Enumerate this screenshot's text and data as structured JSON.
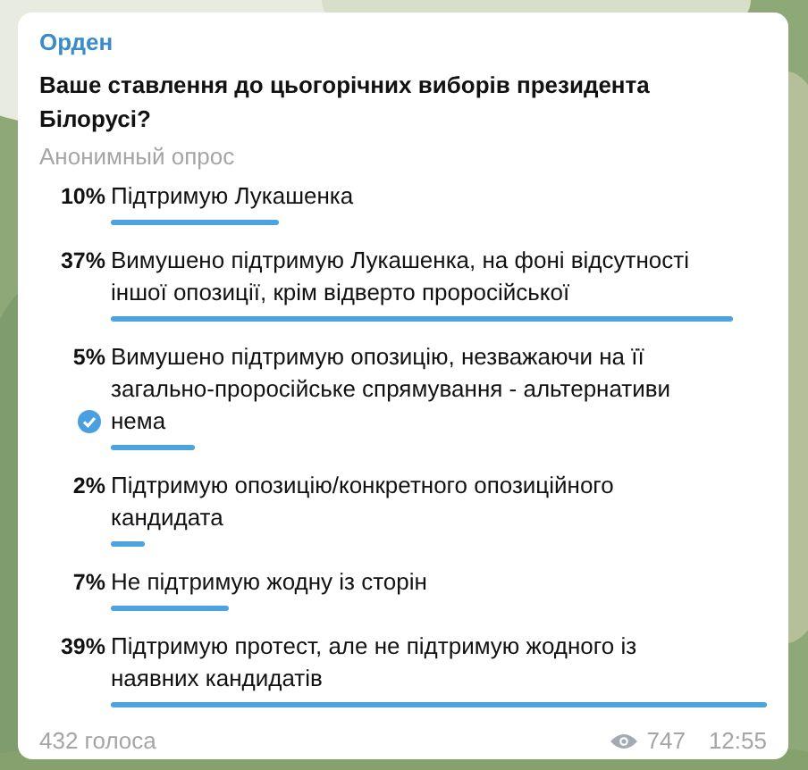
{
  "poll": {
    "author": "Орден",
    "question": "Ваше ставлення до цьогорічних виборів президента Білорусі?",
    "type_label": "Анонимный опрос",
    "options": [
      {
        "percent": "10%",
        "text": "Підтримую Лукашенка",
        "selected": false
      },
      {
        "percent": "37%",
        "text": "Вимушено підтримую Лукашенка, на фоні відсутності іншої опозиції, крім відверто проросійської",
        "selected": false
      },
      {
        "percent": "5%",
        "text": "Вимушено підтримую опозицію, незважаючи на її загально-проросійське спрямування - альтернативи нема",
        "selected": true
      },
      {
        "percent": "2%",
        "text": "Підтримую опозицію/конкретного опозиційного кандидата",
        "selected": false
      },
      {
        "percent": "7%",
        "text": "Не підтримую жодну із сторін",
        "selected": false
      },
      {
        "percent": "39%",
        "text": "Підтримую протест, але не підтримую жодного із наявних кандидатів",
        "selected": false
      }
    ],
    "votes": "432 голоса",
    "views": "747",
    "time": "12:55"
  }
}
